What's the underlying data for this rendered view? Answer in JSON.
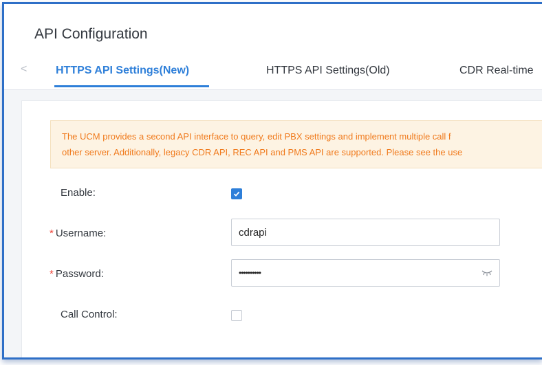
{
  "page": {
    "title": "API Configuration"
  },
  "tabs": [
    {
      "label": "HTTPS API Settings(New)",
      "active": true
    },
    {
      "label": "HTTPS API Settings(Old)",
      "active": false
    },
    {
      "label": "CDR Real-time",
      "active": false
    }
  ],
  "nav": {
    "prev_icon": "<"
  },
  "notice": {
    "line1": "The UCM provides a second API interface to query, edit PBX settings and implement multiple call f",
    "line2": "other server. Additionally, legacy CDR API, REC API and PMS API are supported. Please see the use"
  },
  "form": {
    "enable": {
      "label": "Enable:",
      "checked": true
    },
    "username": {
      "label": "Username:",
      "required_mark": "*",
      "value": "cdrapi"
    },
    "password": {
      "label": "Password:",
      "required_mark": "*",
      "value": "••••••••••",
      "toggle_icon": "eye-closed-icon"
    },
    "call_control": {
      "label": "Call Control:",
      "checked": false
    }
  },
  "colors": {
    "accent": "#2e7fd9",
    "notice_text": "#f07a1c",
    "notice_bg": "#fdf3e3",
    "required": "#f0453a"
  }
}
